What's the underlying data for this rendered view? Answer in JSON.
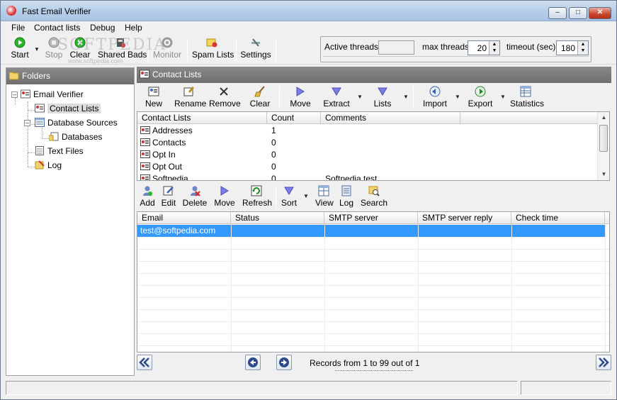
{
  "window": {
    "title": "Fast Email Verifier"
  },
  "watermark": {
    "text": "SOFTPEDIA",
    "url": "www.softpedia.com"
  },
  "menu": [
    "File",
    "Contact lists",
    "Debug",
    "Help"
  ],
  "toolbar": {
    "start": "Start",
    "stop": "Stop",
    "clear": "Clear",
    "shared_bads": "Shared Bads",
    "monitor": "Monitor",
    "spam_lists": "Spam Lists",
    "settings": "Settings"
  },
  "threads": {
    "active_label": "Active threads",
    "max_label": "max threads",
    "max_value": "20",
    "timeout_label": "timeout (sec)",
    "timeout_value": "180"
  },
  "folders": {
    "title": "Folders",
    "nodes": [
      "Email Verifier",
      "Contact Lists",
      "Database Sources",
      "Databases",
      "Text Files",
      "Log"
    ]
  },
  "contact_lists_panel": {
    "title": "Contact Lists",
    "toolbar": {
      "new": "New",
      "rename": "Rename",
      "remove": "Remove",
      "clear": "Clear",
      "move": "Move",
      "extract": "Extract",
      "lists": "Lists",
      "import": "Import",
      "export": "Export",
      "statistics": "Statistics"
    },
    "columns": [
      "Contact Lists",
      "Count",
      "Comments"
    ],
    "rows": [
      {
        "name": "Addresses",
        "count": "1",
        "comment": ""
      },
      {
        "name": "Contacts",
        "count": "0",
        "comment": ""
      },
      {
        "name": "Opt In",
        "count": "0",
        "comment": ""
      },
      {
        "name": "Opt Out",
        "count": "0",
        "comment": ""
      },
      {
        "name": "Softpedia",
        "count": "0",
        "comment": "Softpedia test"
      }
    ]
  },
  "emails_panel": {
    "toolbar": {
      "add": "Add",
      "edit": "Edit",
      "delete": "Delete",
      "move": "Move",
      "refresh": "Refresh",
      "sort": "Sort",
      "view": "View",
      "log": "Log",
      "search": "Search"
    },
    "columns": [
      "Email",
      "Status",
      "SMTP server",
      "SMTP server reply",
      "Check time"
    ],
    "rows": [
      {
        "email": "test@softpedia.com",
        "status": "",
        "smtp": "",
        "reply": "",
        "time": ""
      }
    ],
    "records_text": "Records from 1 to 99  out of 1"
  },
  "colors": {
    "header_gray": "#7a7a7a",
    "selection": "#3399ff",
    "start_green": "#2bb52b"
  }
}
